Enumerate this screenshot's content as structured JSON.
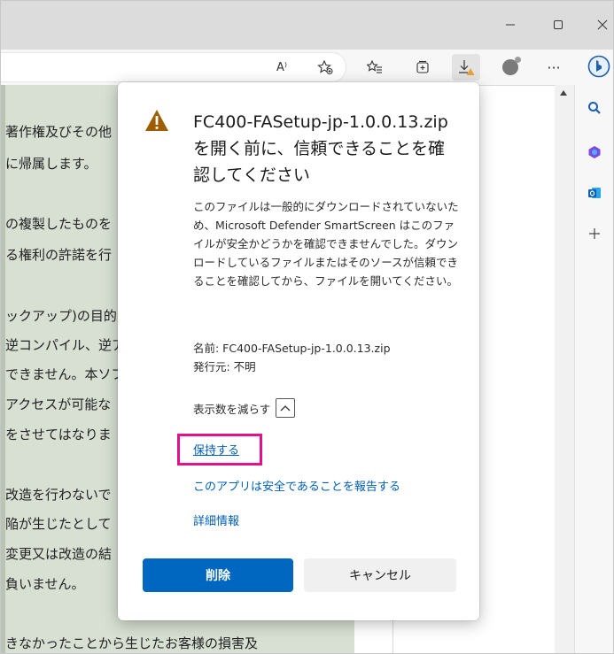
{
  "titlebar": {
    "minimize": "–",
    "maximize": "□",
    "close": "✕"
  },
  "toolbar": {
    "read_aloud_icon": "A⁾"
  },
  "page_content": {
    "lines": [
      "著作権及びその他",
      "に帰属します。",
      "",
      "の複製したものを",
      "る権利の許諾を行",
      "",
      "ックアップ)の目的",
      "逆コンパイル、逆ア",
      "できません。本ソフ",
      "アクセスが可能な",
      "をさせてはなりま",
      "",
      "改造を行わないで",
      "陥が生じたとして",
      "変更又は改造の結",
      "負いません。",
      "",
      "きなかったことから生じたお客様の損害及"
    ]
  },
  "dialog": {
    "title": "FC400-FASetup-jp-1.0.0.13.zipを開く前に、信頼できることを確認してください",
    "body": "このファイルは一般的にダウンロードされていないため、Microsoft Defender SmartScreen はこのファイルが安全かどうかを確認できませんでした。ダウンロードしているファイルまたはそのソースが信頼できることを確認してから、ファイルを開いてください。",
    "name_line": "名前: FC400-FASetup-jp-1.0.0.13.zip",
    "publisher_line": "発行元: 不明",
    "show_less_label": "表示数を減らす",
    "keep_link": "保持する",
    "report_link": "このアプリは安全であることを報告する",
    "more_info_link": "詳細情報",
    "delete_button": "削除",
    "cancel_button": "キャンセル"
  },
  "colors": {
    "accent": "#0067c0",
    "link": "#005fb8",
    "warning": "#9d5d00",
    "highlight": "#e0138c",
    "page_bg": "#d7e0d3"
  }
}
